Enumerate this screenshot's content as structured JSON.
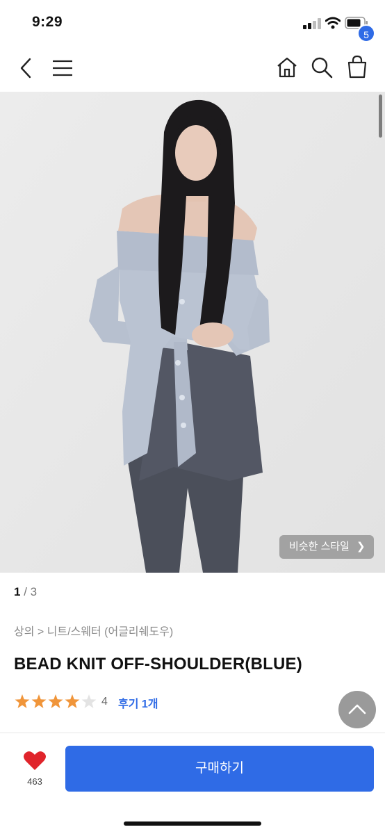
{
  "status_bar": {
    "time": "9:29"
  },
  "nav": {
    "cart_count": "5"
  },
  "gallery": {
    "current": "1",
    "separator": " / ",
    "total": "3",
    "similar_label": "비슷한 스타일"
  },
  "product": {
    "breadcrumb": "상의 > 니트/스웨터 (어글리쉐도우)",
    "title": "BEAD KNIT OFF-SHOULDER(BLUE)",
    "rating_value": 4,
    "rating_text": "4",
    "reviews_label": "후기 1개"
  },
  "bottom_bar": {
    "like_count": "463",
    "buy_label": "구매하기"
  },
  "colors": {
    "accent": "#2f6be6",
    "star": "#f0953a",
    "heart": "#e0242b"
  }
}
